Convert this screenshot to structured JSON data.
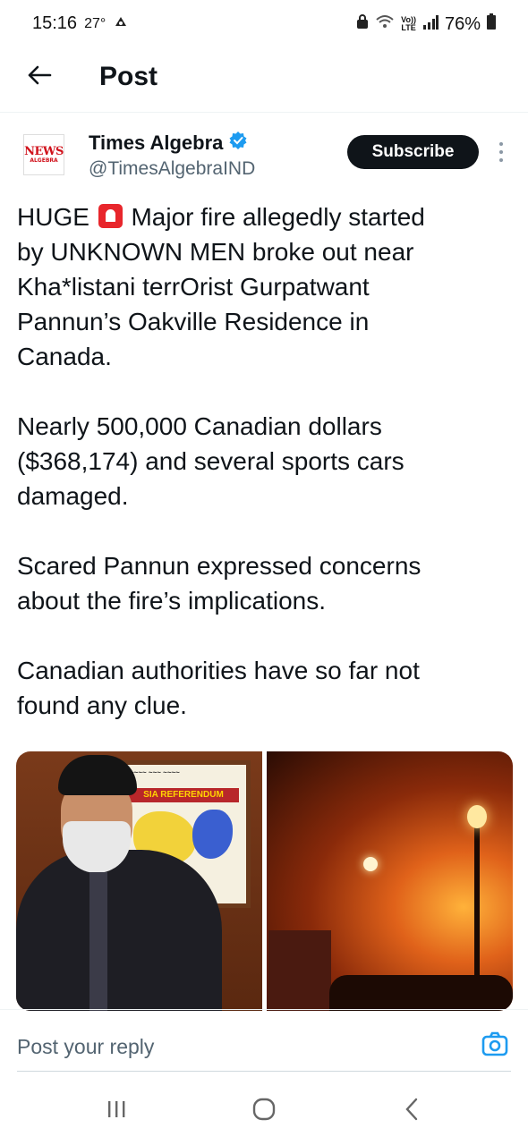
{
  "status_bar": {
    "time": "15:16",
    "temperature": "27°",
    "network": "VoLTE",
    "battery": "76%"
  },
  "header": {
    "title": "Post"
  },
  "post": {
    "author": {
      "name": "Times Algebra",
      "handle": "@TimesAlgebraIND",
      "verified": true,
      "avatar_text_top": "NEWS",
      "avatar_text_bottom": "ALGEBRA"
    },
    "subscribe_label": "Subscribe",
    "paragraphs": [
      {
        "line_1_before_emoji": "HUGE",
        "line_1_after_emoji": "Major fire allegedly started",
        "lines": [
          "by UNKNOWN MEN broke out near",
          "Kha*listani terrOrist Gurpatwant",
          "Pannun’s Oakville Residence in",
          "Canada."
        ]
      },
      {
        "lines": [
          "Nearly 500,000 Canadian dollars",
          "($368,174) and several sports cars",
          "damaged."
        ]
      },
      {
        "lines": [
          "Scared Pannun expressed concerns",
          "about the fire’s implications."
        ]
      },
      {
        "lines": [
          "Canadian authorities have so far not",
          "found any clue."
        ]
      }
    ],
    "media": {
      "left_board_banner": "SIA REFERENDUM"
    }
  },
  "reply": {
    "placeholder": "Post your reply"
  },
  "colors": {
    "text": "#0f1419",
    "secondary": "#536471",
    "accent": "#1d9bf0",
    "subscribe_bg": "#0f1419"
  },
  "icons": {
    "back": "arrow-left-icon",
    "verified": "verified-badge-icon",
    "more": "more-vertical-icon",
    "camera": "camera-icon",
    "nav_recents": "recents-icon",
    "nav_home": "home-icon",
    "nav_back": "chevron-left-icon"
  }
}
